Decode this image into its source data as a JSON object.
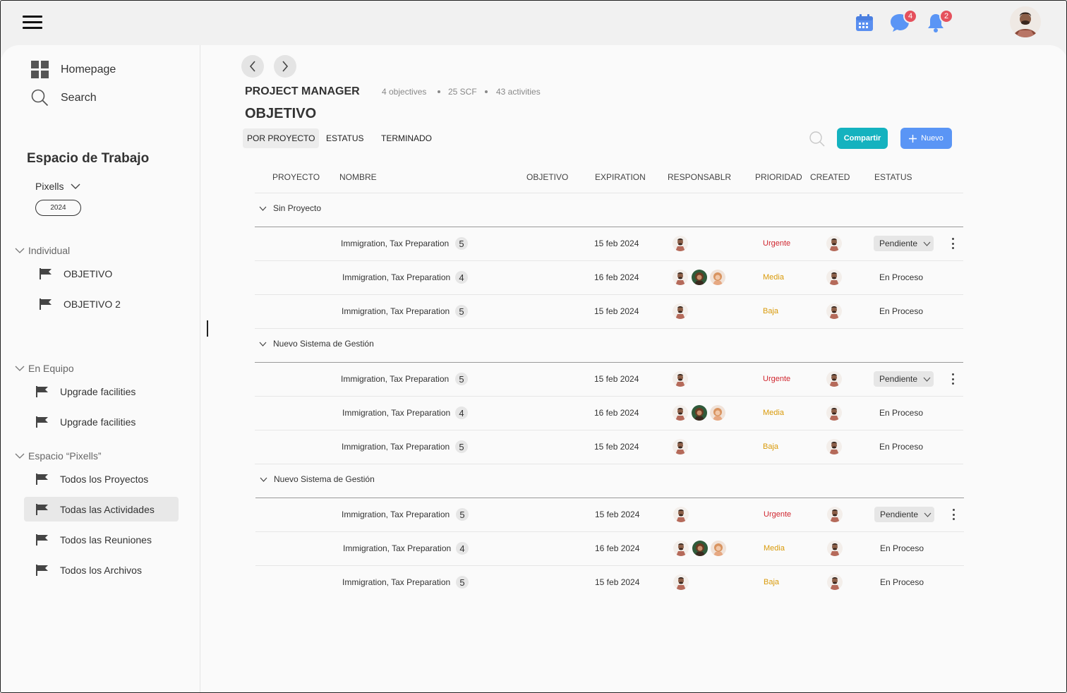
{
  "topbar": {
    "notifications": {
      "messages_count": "4",
      "alerts_count": "2"
    },
    "icons": [
      "menu-icon",
      "calendar-icon",
      "chat-icon",
      "bell-icon",
      "user-avatar"
    ],
    "colors": {
      "accent": "#5a95f5",
      "badge": "#e5515d",
      "share": "#14b2bf"
    }
  },
  "sidebar": {
    "homepage": "Homepage",
    "search": "Search",
    "workspace_title": "Espacio de Trabajo",
    "workspace_select": "Pixells",
    "year": "2024",
    "sections": [
      {
        "label": "Individual",
        "items": [
          "OBJETIVO",
          "OBJETIVO 2"
        ]
      },
      {
        "label": "En Equipo",
        "items": [
          "Upgrade facilities",
          "Upgrade facilities"
        ]
      },
      {
        "label": "Espacio “Pixells”",
        "items": [
          "Todos los Proyectos",
          "Todas las Actividades",
          "Todos las Reuniones",
          "Todos los Archivos"
        ]
      }
    ],
    "active_item": "Todas las Actividades"
  },
  "header": {
    "title": "PROJECT MANAGER",
    "meta": [
      "4 objectives",
      "25 SCF",
      "43 activities"
    ],
    "subtitle": "OBJETIVO",
    "tabs": [
      "POR PROYECTO",
      "ESTATUS",
      "TERMINADO"
    ],
    "active_tab": "POR PROYECTO",
    "share_label": "Compartir",
    "new_label": "Nuevo"
  },
  "table": {
    "columns": [
      "PROYECTO",
      "NOMBRE",
      "OBJETIVO",
      "EXPIRATION",
      "RESPONSABLR",
      "PRIORIDAD",
      "CREATED",
      "ESTATUS"
    ],
    "groups": [
      {
        "label": "Sin Proyecto",
        "rows": [
          {
            "name": "Immigration, Tax Preparation",
            "count": "5",
            "expiration": "15 feb 2024",
            "assignees": 1,
            "priority": "Urgente",
            "status": "Pendiente",
            "status_dropdown": true
          },
          {
            "name": "Immigration, Tax Preparation",
            "count": "4",
            "expiration": "16 feb 2024",
            "assignees": 3,
            "priority": "Media",
            "status": "En Proceso",
            "status_dropdown": false
          },
          {
            "name": "Immigration, Tax Preparation",
            "count": "5",
            "expiration": "15 feb 2024",
            "assignees": 1,
            "priority": "Baja",
            "status": "En Proceso",
            "status_dropdown": false
          }
        ]
      },
      {
        "label": "Nuevo Sistema de Gestión",
        "rows": [
          {
            "name": "Immigration, Tax Preparation",
            "count": "5",
            "expiration": "15 feb 2024",
            "assignees": 1,
            "priority": "Urgente",
            "status": "Pendiente",
            "status_dropdown": true
          },
          {
            "name": "Immigration, Tax Preparation",
            "count": "4",
            "expiration": "16 feb 2024",
            "assignees": 3,
            "priority": "Media",
            "status": "En Proceso",
            "status_dropdown": false
          },
          {
            "name": "Immigration, Tax Preparation",
            "count": "5",
            "expiration": "15 feb 2024",
            "assignees": 1,
            "priority": "Baja",
            "status": "En Proceso",
            "status_dropdown": false
          }
        ]
      },
      {
        "label": "Nuevo Sistema de Gestión",
        "rows": [
          {
            "name": "Immigration, Tax Preparation",
            "count": "5",
            "expiration": "15 feb 2024",
            "assignees": 1,
            "priority": "Urgente",
            "status": "Pendiente",
            "status_dropdown": true
          },
          {
            "name": "Immigration, Tax Preparation",
            "count": "4",
            "expiration": "16 feb 2024",
            "assignees": 3,
            "priority": "Media",
            "status": "En Proceso",
            "status_dropdown": false
          },
          {
            "name": "Immigration, Tax Preparation",
            "count": "5",
            "expiration": "15 feb 2024",
            "assignees": 1,
            "priority": "Baja",
            "status": "En Proceso",
            "status_dropdown": false
          }
        ]
      }
    ],
    "priority_colors": {
      "Urgente": "#d0262f",
      "Media": "#d99a0a",
      "Baja": "#d99a0a"
    }
  }
}
